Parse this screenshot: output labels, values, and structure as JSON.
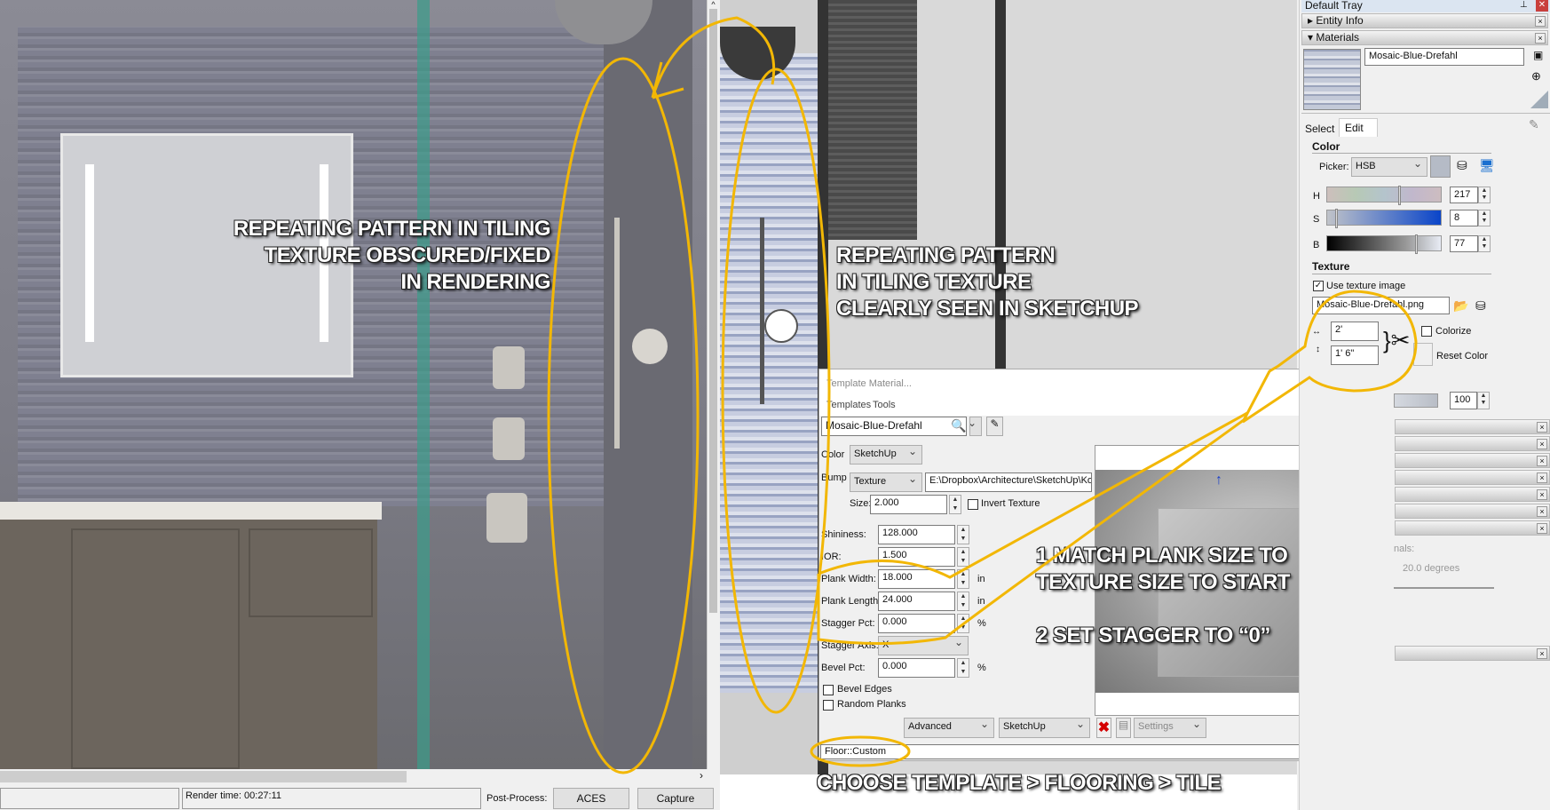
{
  "render_view": {
    "status_left": "",
    "render_time": "Render time: 00:27:11",
    "post_process_label": "Post-Process:",
    "post_process_value": "ACES",
    "capture_label": "Capture"
  },
  "annotations": {
    "rendering": [
      "REPEATING PATTERN IN TILING",
      "TEXTURE OBSCURED/FIXED",
      "IN RENDERING"
    ],
    "sketchup": [
      "REPEATING PATTERN",
      "IN TILING TEXTURE",
      "CLEARLY SEEN IN SKETCHUP"
    ],
    "step1": [
      "1 MATCH PLANK SIZE TO",
      "TEXTURE SIZE TO START"
    ],
    "step2": "2 SET STAGGER TO “0”",
    "choose": "CHOOSE TEMPLATE > FLOORING > TILE",
    "highlight_color": "#f2b705"
  },
  "template_dialog": {
    "title": "Template Material...",
    "menu": [
      "Templates",
      "Tools"
    ],
    "material_name": "Mosaic-Blue-Drefahl",
    "color_label": "Color",
    "color_value": "SketchUp",
    "bump_label": "Bump",
    "bump_value": "Texture",
    "bump_path": "E:\\Dropbox\\Architecture\\SketchUp\\Kohl",
    "size_label": "Size:",
    "size_value": "2.000",
    "invert_label": "Invert Texture",
    "fields": [
      {
        "label": "Shininess:",
        "value": "128.000",
        "unit": ""
      },
      {
        "label": "IOR:",
        "value": "1.500",
        "unit": ""
      },
      {
        "label": "Plank Width:",
        "value": "18.000",
        "unit": "in"
      },
      {
        "label": "Plank Length:",
        "value": "24.000",
        "unit": "in"
      },
      {
        "label": "Stagger Pct:",
        "value": "0.000",
        "unit": "%"
      }
    ],
    "stagger_axis_label": "Stagger Axis:",
    "stagger_axis_value": "X",
    "bevel_label": "Bevel Pct:",
    "bevel_value": "0.000",
    "bevel_unit": "%",
    "bevel_edges": "Bevel Edges",
    "random_planks": "Random Planks",
    "mode_value": "Advanced",
    "engine_value": "SketchUp",
    "settings_value": "Settings",
    "status": "Floor::Custom"
  },
  "tray": {
    "title": "Default Tray",
    "entity_info": "Entity Info",
    "materials": "Materials",
    "material_name": "Mosaic-Blue-Drefahl",
    "tabs": [
      "Select",
      "Edit"
    ],
    "color_heading": "Color",
    "picker_label": "Picker:",
    "picker_value": "HSB",
    "h_label": "H",
    "h_value": "217",
    "s_label": "S",
    "s_value": "8",
    "b_label": "B",
    "b_value": "77",
    "texture_heading": "Texture",
    "use_texture": "Use texture image",
    "texture_file": "Mosaic-Blue-Drefahl.png",
    "width_value": "2'",
    "height_value": "1' 6\"",
    "colorize": "Colorize",
    "reset_color": "Reset Color",
    "opacity_value": "100",
    "partial_label": "nals:",
    "degrees": "20.0  degrees"
  }
}
